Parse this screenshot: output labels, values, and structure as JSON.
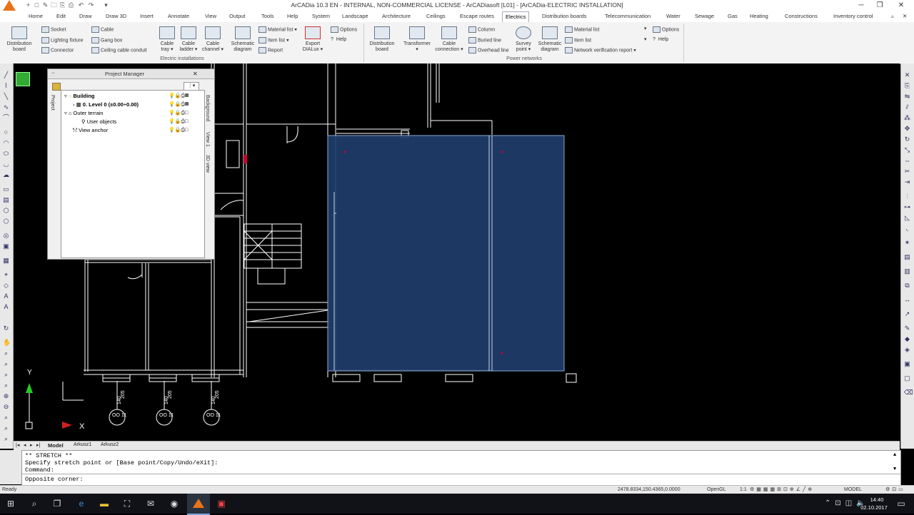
{
  "window": {
    "title": "ArCADia 10.3 EN - INTERNAL, NON-COMMERCIAL LICENSE - ArCADiasoft [L01] - [ArCADia-ELECTRIC INSTALLATION]",
    "quick_access": [
      "+",
      "□",
      "✎",
      "🗀",
      "⎘",
      "⎙",
      "↶",
      "↷",
      "▾"
    ],
    "min": "─",
    "restore": "❐",
    "close": "✕"
  },
  "menu": {
    "items": [
      "Home",
      "Edit",
      "Draw",
      "Draw 3D",
      "Insert",
      "Annotate",
      "View",
      "Output",
      "Tools",
      "Help",
      "System",
      "Landscape",
      "Architecture",
      "Ceilings",
      "Escape routes",
      "Electrics",
      "Distribution boards",
      "Telecommunication",
      "Water",
      "Sewage",
      "Gas",
      "Heating",
      "Constructions",
      "Inventory control"
    ],
    "active": "Electrics",
    "ribbon_min": "▵",
    "ribbon_close": "✕"
  },
  "ribbon": {
    "electric": {
      "distribution_board": [
        "Distribution",
        "board"
      ],
      "socket": "Socket",
      "lighting_fixture": "Lighting fixture",
      "connector": "Connector",
      "cable": "Cable",
      "gang_box": "Gang box",
      "ceiling_cable_conduit": "Ceiling cable conduit",
      "cable_tray": [
        "Cable",
        "tray ▾"
      ],
      "cable_ladder": [
        "Cable",
        "ladder ▾"
      ],
      "cable_channel": [
        "Cable",
        "channel ▾"
      ],
      "schematic_diagram": [
        "Schematic",
        "diagram"
      ],
      "material_list": "Material list",
      "item_list": "Item list",
      "report": "Report",
      "export": [
        "Export",
        "DIALux ▾"
      ],
      "options": "Options",
      "help": "Help",
      "group": "Electric installations"
    },
    "power": {
      "distribution_board": [
        "Distribution",
        "board"
      ],
      "transformer": [
        "Transformer",
        "▾"
      ],
      "cable_connection": [
        "Cable",
        "connection ▾"
      ],
      "column": "Column",
      "buried_line": "Buried line",
      "overhead_line": "Overhead line",
      "survey_point": [
        "Survey",
        "point ▾"
      ],
      "schematic_diagram": [
        "Schematic",
        "diagram"
      ],
      "material_list": "Material list",
      "item_list": "Item list",
      "network_verification": "Network verification report",
      "options": "Options",
      "help": "Help",
      "group": "Power networks"
    }
  },
  "project_manager": {
    "title": "Project Manager",
    "close": "✕",
    "tree": [
      {
        "label": "Building",
        "bold": true
      },
      {
        "label": "0. Level 0 (±0.00÷0.00)",
        "bold": true
      },
      {
        "label": "Outer terrain",
        "bold": false
      },
      {
        "label": "User objects",
        "bold": false
      },
      {
        "label": "View anchor",
        "bold": false
      }
    ],
    "tab_project": "Project",
    "tab_background": "Background",
    "tab_view1": "View 1",
    "tab_3dview": "3D view"
  },
  "drawing": {
    "labels": [
      "140",
      "205",
      "OO 11"
    ],
    "axis_x": "X",
    "axis_y": "Y"
  },
  "tabs": [
    "Model",
    "Arkusz1",
    "Arkusz2"
  ],
  "tab_nav": [
    "|◂",
    "◂",
    "▸",
    "▸|"
  ],
  "command": {
    "lines": [
      "** STRETCH **",
      "Specify stretch point or [Base point/Copy/Undo/eXit]:",
      "Command:"
    ],
    "prompt": "Opposite corner:"
  },
  "status": {
    "ready": "Ready",
    "coords": "2478.8334,150.4365,0.0000",
    "opengl": "OpenGL",
    "scale": "1:1",
    "model": "MODEL"
  },
  "taskbar": {
    "time": "14:40",
    "date": "02.10.2017"
  }
}
